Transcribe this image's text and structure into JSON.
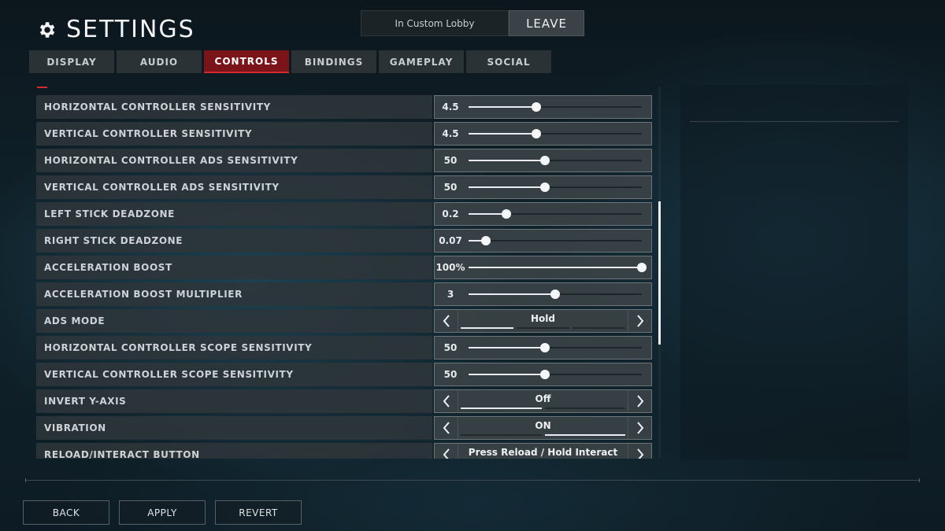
{
  "header": {
    "title": "SETTINGS",
    "lobby_status": "In Custom Lobby",
    "leave_label": "LEAVE"
  },
  "tabs": [
    {
      "label": "DISPLAY",
      "active": false
    },
    {
      "label": "AUDIO",
      "active": false
    },
    {
      "label": "CONTROLS",
      "active": true
    },
    {
      "label": "BINDINGS",
      "active": false
    },
    {
      "label": "GAMEPLAY",
      "active": false
    },
    {
      "label": "SOCIAL",
      "active": false
    }
  ],
  "settings": [
    {
      "label": "HORIZONTAL CONTROLLER SENSITIVITY",
      "type": "slider",
      "value": "4.5",
      "level": 0.39
    },
    {
      "label": "VERTICAL CONTROLLER SENSITIVITY",
      "type": "slider",
      "value": "4.5",
      "level": 0.39
    },
    {
      "label": "HORIZONTAL CONTROLLER ADS SENSITIVITY",
      "type": "slider",
      "value": "50",
      "level": 0.44
    },
    {
      "label": "VERTICAL CONTROLLER ADS SENSITIVITY",
      "type": "slider",
      "value": "50",
      "level": 0.44
    },
    {
      "label": "LEFT STICK DEADZONE",
      "type": "slider",
      "value": "0.2",
      "level": 0.22
    },
    {
      "label": "RIGHT STICK DEADZONE",
      "type": "slider",
      "value": "0.07",
      "level": 0.1
    },
    {
      "label": "ACCELERATION BOOST",
      "type": "slider",
      "value": "100%",
      "level": 1.0
    },
    {
      "label": "ACCELERATION BOOST MULTIPLIER",
      "type": "slider",
      "value": "3",
      "level": 0.5
    },
    {
      "label": "ADS MODE",
      "type": "selector",
      "value": "Hold",
      "options_count": 3,
      "selected_index": 0
    },
    {
      "label": "HORIZONTAL CONTROLLER SCOPE SENSITIVITY",
      "type": "slider",
      "value": "50",
      "level": 0.44
    },
    {
      "label": "VERTICAL CONTROLLER SCOPE SENSITIVITY",
      "type": "slider",
      "value": "50",
      "level": 0.44
    },
    {
      "label": "INVERT Y-AXIS",
      "type": "selector",
      "value": "Off",
      "options_count": 2,
      "selected_index": 0
    },
    {
      "label": "VIBRATION",
      "type": "selector",
      "value": "ON",
      "options_count": 2,
      "selected_index": 1
    },
    {
      "label": "RELOAD/INTERACT BUTTON",
      "type": "selector",
      "value": "Press Reload / Hold Interact",
      "options_count": 3,
      "selected_index": 0
    }
  ],
  "footer": {
    "back_label": "BACK",
    "apply_label": "APPLY",
    "revert_label": "REVERT"
  },
  "icons": {
    "settings": "gear-icon",
    "prev": "chevron-left-icon",
    "next": "chevron-right-icon"
  },
  "colors": {
    "accent": "#d42a2f",
    "active_tab": "#7b1419"
  }
}
